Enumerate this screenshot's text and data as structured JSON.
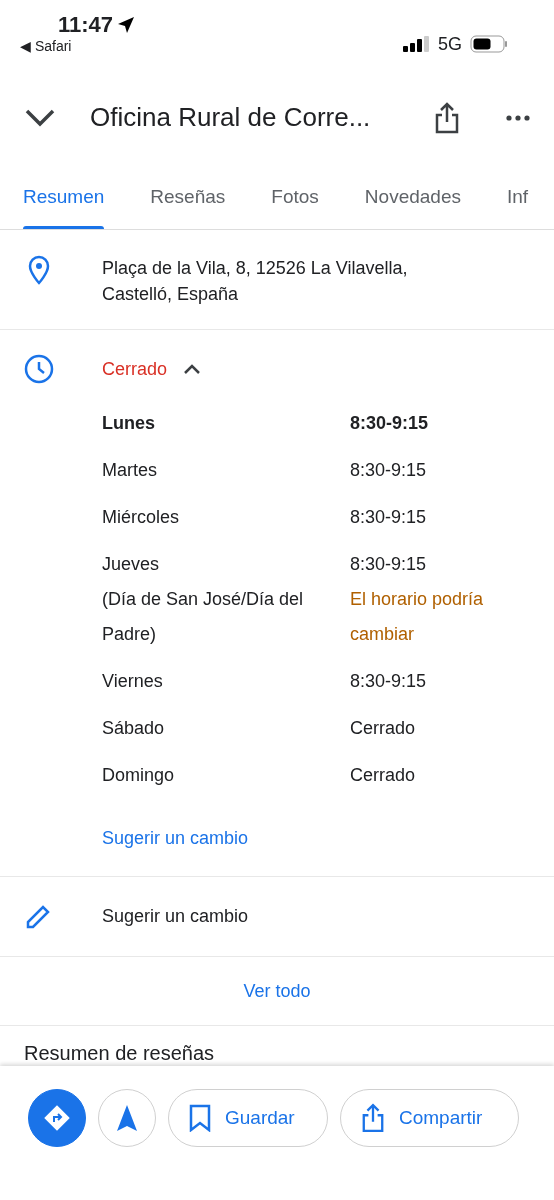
{
  "status_bar": {
    "time": "11:47",
    "back_app": "◀ Safari",
    "network": "5G"
  },
  "header": {
    "title": "Oficina Rural de Corre..."
  },
  "tabs": [
    {
      "label": "Resumen",
      "selected": true
    },
    {
      "label": "Reseñas",
      "selected": false
    },
    {
      "label": "Fotos",
      "selected": false
    },
    {
      "label": "Novedades",
      "selected": false
    },
    {
      "label": "Inf",
      "selected": false
    }
  ],
  "address": "Plaça de la Vila, 8, 12526 La Vilavella, Castelló, España",
  "hours": {
    "status": "Cerrado",
    "expanded": true,
    "days": [
      {
        "day": "Lunes",
        "time": "8:30-9:15",
        "today": true
      },
      {
        "day": "Martes",
        "time": "8:30-9:15",
        "today": false
      },
      {
        "day": "Miércoles",
        "time": "8:30-9:15",
        "today": false
      },
      {
        "day": "Jueves",
        "time": "8:30-9:15",
        "today": false,
        "note": "(Día de San José/Día del Padre)",
        "warning": "El horario podría cambiar"
      },
      {
        "day": "Viernes",
        "time": "8:30-9:15",
        "today": false
      },
      {
        "day": "Sábado",
        "time": "Cerrado",
        "today": false
      },
      {
        "day": "Domingo",
        "time": "Cerrado",
        "today": false
      }
    ],
    "suggest_link": "Sugerir un cambio"
  },
  "suggest_row": "Sugerir un cambio",
  "see_all": "Ver todo",
  "reviews_heading": "Resumen de reseñas",
  "actions": [
    {
      "kind": "directions"
    },
    {
      "kind": "start"
    },
    {
      "kind": "save",
      "label": "Guardar"
    },
    {
      "kind": "share",
      "label": "Compartir"
    }
  ]
}
